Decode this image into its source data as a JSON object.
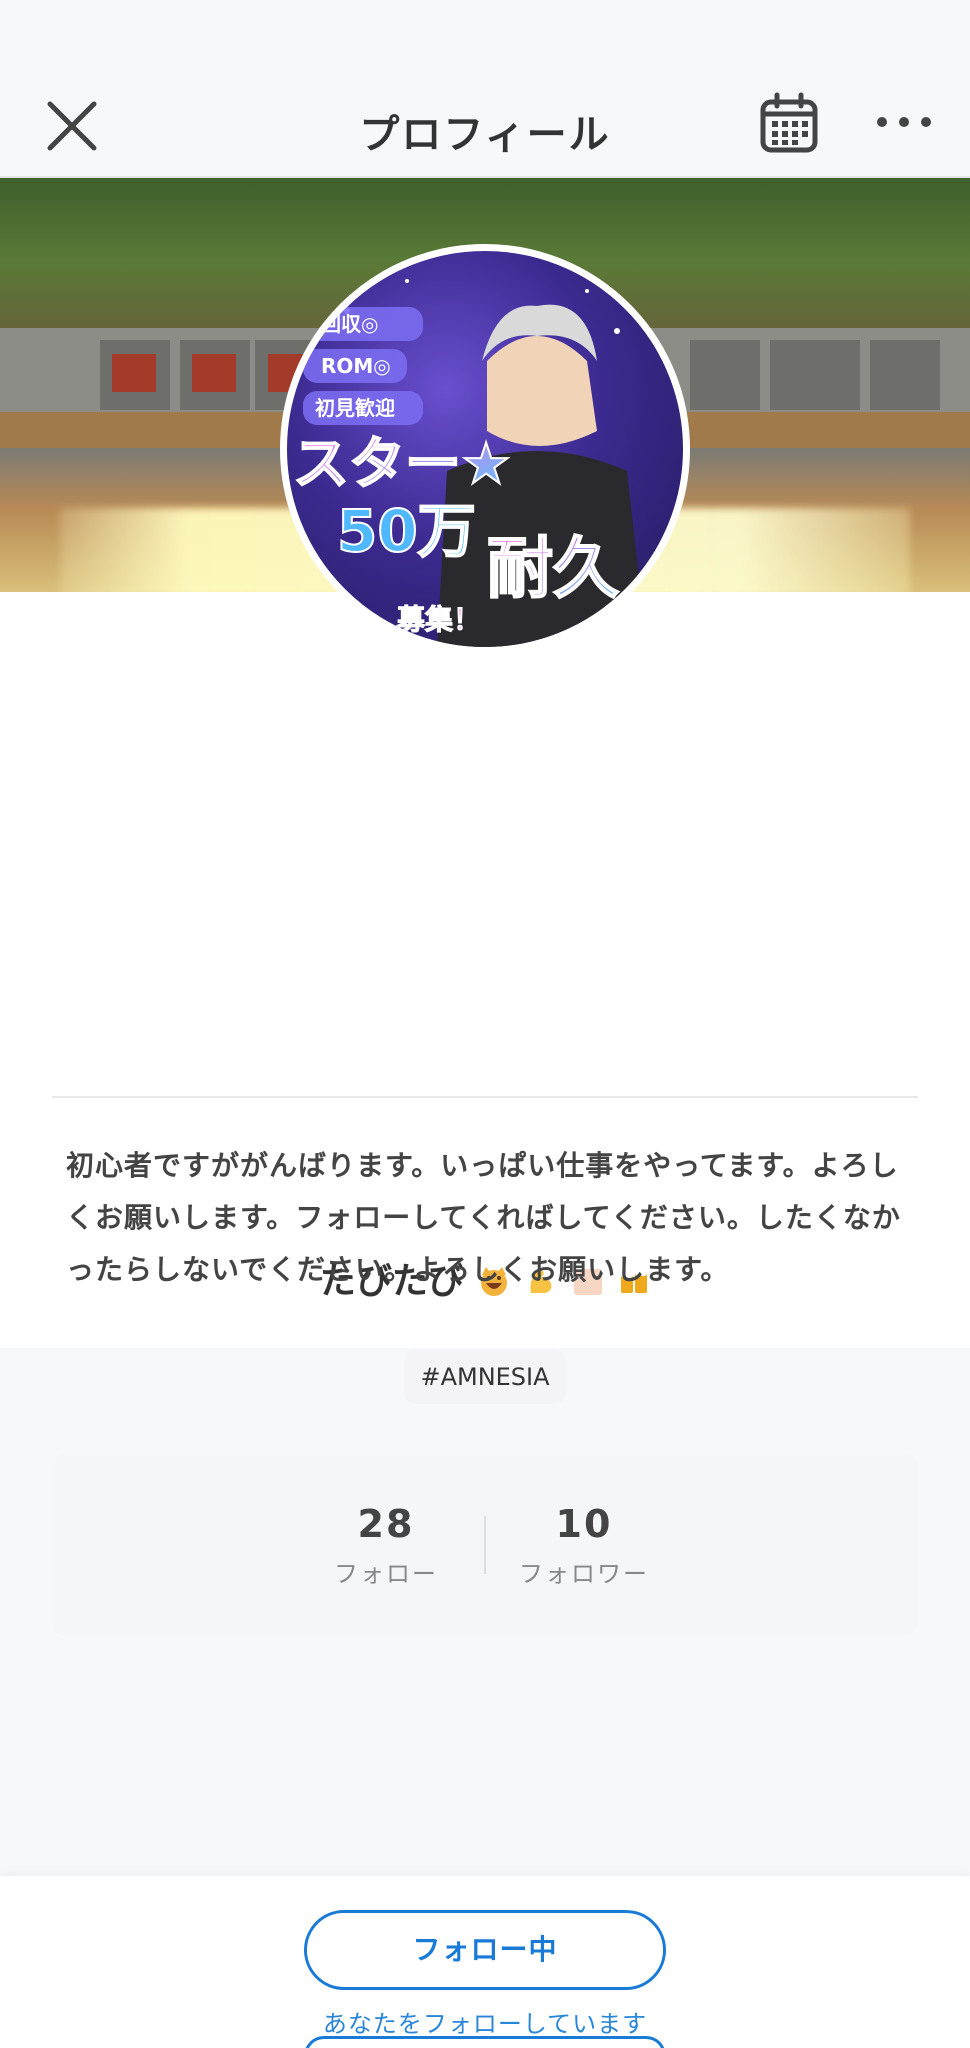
{
  "header": {
    "title": "プロフィール",
    "close_icon": "close-icon",
    "calendar_icon": "calendar-icon",
    "more_icon": "more-icon"
  },
  "profile": {
    "username": "たびたび",
    "username_emojis": [
      "cat-grin-emoji",
      "flexed-biceps-emoji",
      "skin-tone-square",
      "beer-mugs-emoji"
    ],
    "tag": "#AMNESIA",
    "stats": {
      "following_count": "28",
      "following_label": "フォロー",
      "followers_count": "10",
      "followers_label": "フォロワー"
    },
    "bio": "初心者ですががんばります。いっぱい仕事をやってます。よろしくお願いします。フォローしてくればしてください。したくなかったらしないでください。よろしくお願いします。"
  },
  "avatar_art": {
    "lines": [
      "回収◎",
      "ROM◎",
      "初見歓迎",
      "スター★",
      "50万",
      "耐久",
      "募集！"
    ]
  },
  "footer": {
    "follow_button_label": "フォロー中",
    "follows_you_text": "あなたをフォローしています"
  },
  "colors": {
    "accent": "#1a7bd6",
    "background": "#f7f8fa"
  }
}
